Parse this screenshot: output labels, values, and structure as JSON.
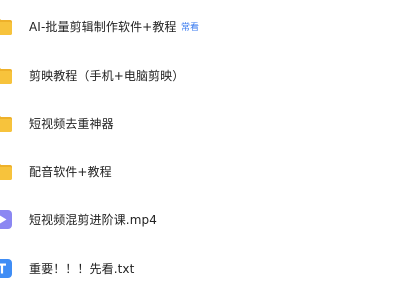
{
  "files": [
    {
      "name": "AI-批量剪辑制作软件+教程",
      "icon": "folder-icon",
      "badge": "常看"
    },
    {
      "name": "剪映教程（手机+电脑剪映）",
      "icon": "folder-icon"
    },
    {
      "name": "短视频去重神器",
      "icon": "folder-icon"
    },
    {
      "name": "配音软件+教程",
      "icon": "folder-icon"
    },
    {
      "name": "短视频混剪进阶课.mp4",
      "icon": "video-file-icon"
    },
    {
      "name": "重要！！！先看.txt",
      "icon": "text-file-icon"
    }
  ],
  "colors": {
    "folder": "#f7c33c",
    "folder_dark": "#eeb12a",
    "video": "#8b87f2",
    "text_file": "#3f8df5",
    "badge": "#3a7bf0"
  }
}
